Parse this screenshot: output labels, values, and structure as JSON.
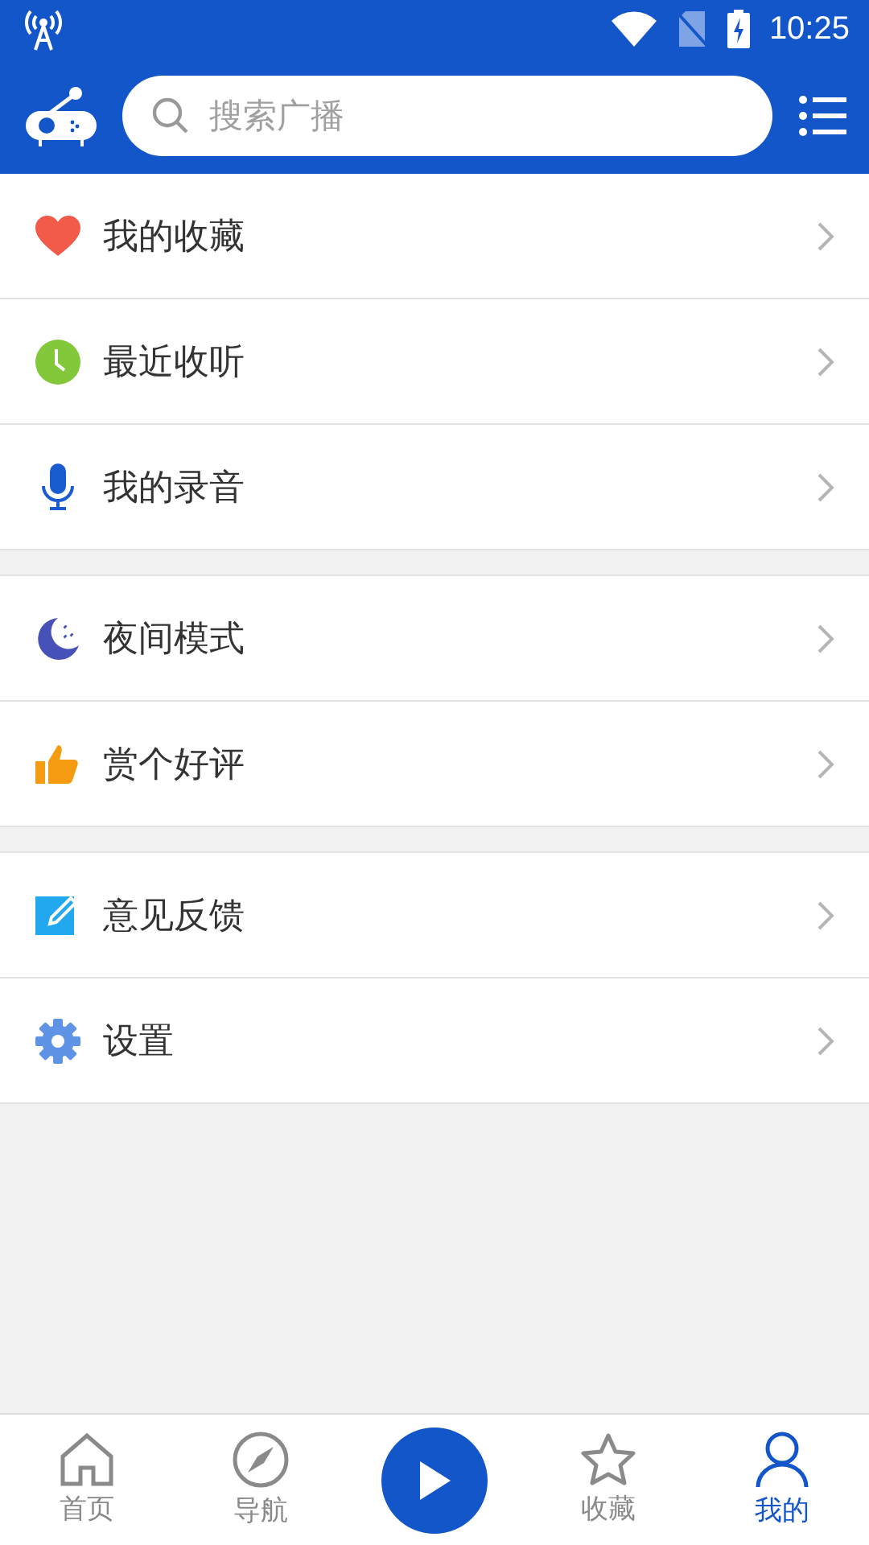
{
  "status_bar": {
    "time": "10:25"
  },
  "search": {
    "placeholder": "搜索广播"
  },
  "menu_groups": [
    {
      "items": [
        {
          "kind": "heart",
          "label": "我的收藏"
        },
        {
          "kind": "clock",
          "label": "最近收听"
        },
        {
          "kind": "mic",
          "label": "我的录音"
        }
      ]
    },
    {
      "items": [
        {
          "kind": "moon",
          "label": "夜间模式"
        },
        {
          "kind": "thumb",
          "label": "赏个好评"
        }
      ]
    },
    {
      "items": [
        {
          "kind": "edit",
          "label": "意见反馈"
        },
        {
          "kind": "gear",
          "label": "设置"
        }
      ]
    }
  ],
  "bottom_nav": [
    {
      "kind": "home",
      "label": "首页",
      "selected": false
    },
    {
      "kind": "compass",
      "label": "导航",
      "selected": false
    },
    {
      "kind": "play",
      "selected": false
    },
    {
      "kind": "star",
      "label": "收藏",
      "selected": false
    },
    {
      "kind": "user",
      "label": "我的",
      "selected": true
    }
  ]
}
